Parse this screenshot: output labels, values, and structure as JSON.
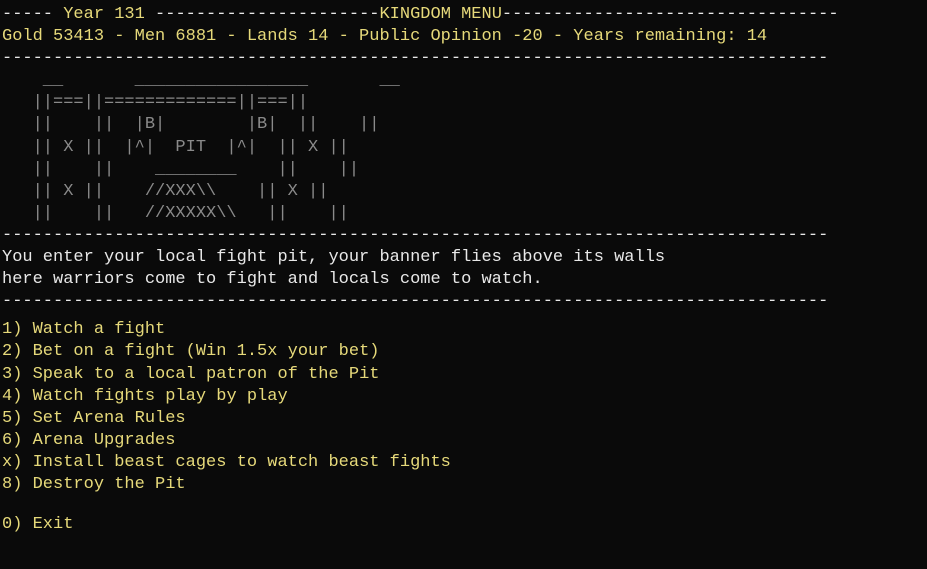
{
  "header": {
    "dash_prefix": "----- ",
    "year_label": "Year",
    "year_value": "131",
    "mid_dashes": " ----------------------",
    "title": "KINGDOM MENU",
    "dash_suffix": "---------------------------------",
    "stats_line": "Gold 53413 - Men 6881 - Lands 14 - Public Opinion -20 - Years remaining: 14",
    "separator": "---------------------------------------------------------------------------------"
  },
  "ascii_art": [
    "    __       _________________       __",
    "   ||===||=============||===||",
    "   ||    ||  |B|        |B|  ||    ||",
    "   || X ||  |^|  PIT  |^|  || X ||",
    "   ||    ||    ________    ||    ||",
    "   || X ||    //XXX\\\\    || X ||",
    "   ||    ||   //XXXXX\\\\   ||    ||"
  ],
  "separator2": "---------------------------------------------------------------------------------",
  "flavor": [
    "You enter your local fight pit, your banner flies above its walls",
    "here warriors come to fight and locals come to watch."
  ],
  "separator3": "---------------------------------------------------------------------------------",
  "menu": {
    "items": [
      {
        "key": "1)",
        "label": "Watch a fight"
      },
      {
        "key": "2)",
        "label": "Bet on a fight (Win 1.5x your bet)"
      },
      {
        "key": "3)",
        "label": "Speak to a local patron of the Pit"
      },
      {
        "key": "4)",
        "label": "Watch fights play by play"
      },
      {
        "key": "5)",
        "label": "Set Arena Rules"
      },
      {
        "key": "6)",
        "label": "Arena Upgrades"
      },
      {
        "key": "x)",
        "label": "Install beast cages to watch beast fights"
      },
      {
        "key": "8)",
        "label": "Destroy the Pit"
      }
    ],
    "exit": {
      "key": "0)",
      "label": "Exit"
    }
  }
}
